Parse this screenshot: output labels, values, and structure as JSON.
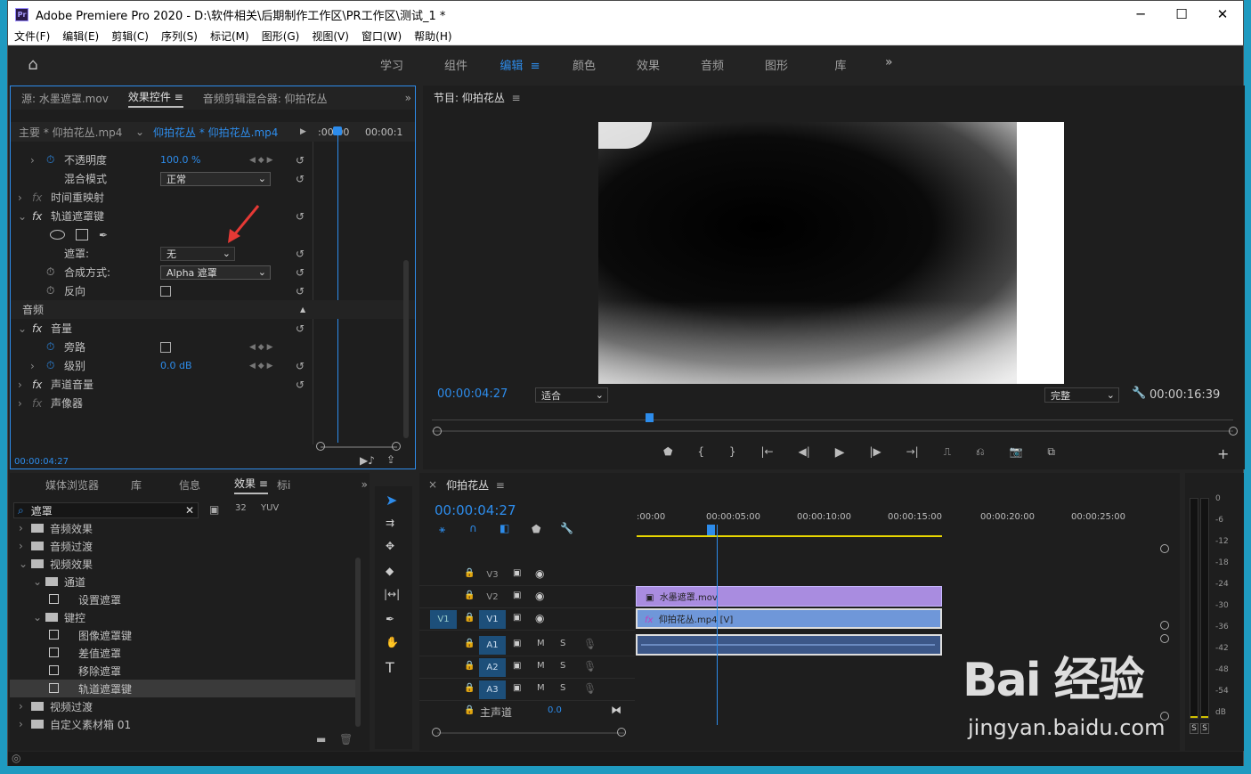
{
  "title": "Adobe Premiere Pro 2020 - D:\\软件相关\\后期制作工作区\\PR工作区\\测试_1 *",
  "menu": [
    "文件(F)",
    "编辑(E)",
    "剪辑(C)",
    "序列(S)",
    "标记(M)",
    "图形(G)",
    "视图(V)",
    "窗口(W)",
    "帮助(H)"
  ],
  "workspaces": [
    "学习",
    "组件",
    "编辑",
    "颜色",
    "效果",
    "音频",
    "图形",
    "库"
  ],
  "ec": {
    "tabs": [
      "源: 水墨遮罩.mov",
      "效果控件",
      "音频剪辑混合器: 仰拍花丛"
    ],
    "master": "主要 * 仰拍花丛.mp4",
    "clip": "仰拍花丛 * 仰拍花丛.mp4",
    "t0": ":00:00",
    "t1": "00:00:1",
    "opacity": "不透明度",
    "opacity_val": "100.0 %",
    "blend": "混合模式",
    "blend_val": "正常",
    "timeremap": "时间重映射",
    "trackmatte": "轨道遮罩键",
    "matte": "遮罩:",
    "matte_val": "无",
    "composite": "合成方式:",
    "composite_val": "Alpha 遮罩",
    "reverse": "反向",
    "audio": "音频",
    "volume": "音量",
    "bypass": "旁路",
    "level": "级别",
    "level_val": "0.0 dB",
    "channel": "声道音量",
    "panner": "声像器",
    "time": "00:00:04:27"
  },
  "program": {
    "title": "节目: 仰拍花丛",
    "time": "00:00:04:27",
    "fit": "适合",
    "quality": "完整",
    "duration": "00:00:16:39"
  },
  "effects": {
    "tabs": [
      "媒体浏览器",
      "库",
      "信息",
      "效果",
      "标i"
    ],
    "search": "遮罩",
    "items": [
      {
        "label": "音频效果",
        "indent": 0,
        "type": "folder"
      },
      {
        "label": "音频过渡",
        "indent": 0,
        "type": "folder"
      },
      {
        "label": "视频效果",
        "indent": 0,
        "type": "folder"
      },
      {
        "label": "通道",
        "indent": 1,
        "type": "folder"
      },
      {
        "label": "设置遮罩",
        "indent": 2,
        "type": "fx"
      },
      {
        "label": "键控",
        "indent": 1,
        "type": "folder"
      },
      {
        "label": "图像遮罩键",
        "indent": 2,
        "type": "fx"
      },
      {
        "label": "差值遮罩",
        "indent": 2,
        "type": "fx"
      },
      {
        "label": "移除遮罩",
        "indent": 2,
        "type": "fx"
      },
      {
        "label": "轨道遮罩键",
        "indent": 2,
        "type": "fx"
      },
      {
        "label": "视频过渡",
        "indent": 0,
        "type": "folder"
      },
      {
        "label": "自定义素材箱 01",
        "indent": 0,
        "type": "folder"
      }
    ]
  },
  "timeline": {
    "title": "仰拍花丛",
    "time": "00:00:04:27",
    "ruler": [
      ":00:00",
      "00:00:05:00",
      "00:00:10:00",
      "00:00:15:00",
      "00:00:20:00",
      "00:00:25:00"
    ],
    "tracks": [
      "V3",
      "V2",
      "V1",
      "A1",
      "A2",
      "A3"
    ],
    "src": "V1",
    "master": "主声道",
    "master_val": "0.0",
    "clip_v2": "水墨遮罩.mov",
    "clip_v1": "仰拍花丛.mp4 [V]"
  },
  "meter": [
    "0",
    "-6",
    "-12",
    "-18",
    "-24",
    "-30",
    "-36",
    "-42",
    "-48",
    "-54",
    "dB"
  ],
  "watermark": "Bai 经验",
  "watermark_url": "jingyan.baidu.com"
}
